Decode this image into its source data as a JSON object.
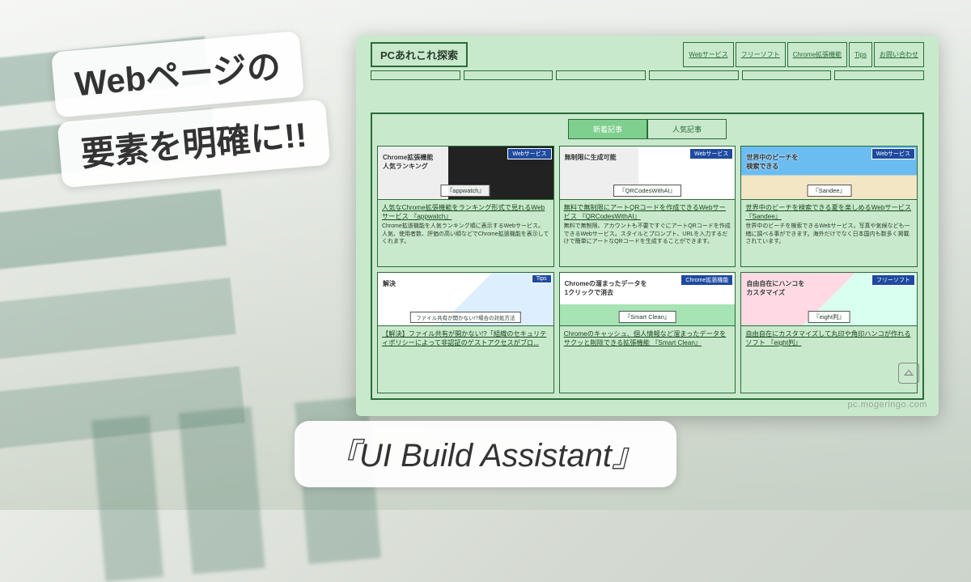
{
  "headline": {
    "line1": "Webページの",
    "line2": "要素を明確に!!"
  },
  "footer_title": "『UI Build Assistant』",
  "watermark": "pc.mogeringo.com",
  "site": {
    "title": "PCあれこれ探索",
    "nav": [
      "Webサービス",
      "フリーソフト",
      "Chrome拡張機能",
      "Tips",
      "お問い合わせ"
    ],
    "tabs": {
      "active": "新着記事",
      "other": "人気記事"
    },
    "cards": [
      {
        "tag": "Webサービス",
        "thumb_caption": "Chrome拡張機能\n人気ランキング",
        "thumb_label": "『appwatch』",
        "thumb_class": "dark",
        "title": "人気なChrome拡張機能をランキング形式で見れるWebサービス 『appwatch』",
        "desc": "Chrome拡張機能を人気ランキング順に表示するWebサービス。人気、使用者数、評価の高い順などでChrome拡張機能を表示してくれます。"
      },
      {
        "tag": "Webサービス",
        "thumb_caption": "無制限に生成可能",
        "thumb_label": "『QRCodesWithAI』",
        "thumb_class": "qr",
        "title": "無料で無制限にアートQRコードを作成できるWebサービス 『QRCodesWithAI』",
        "desc": "無料で無制限、アカウントも不要ですぐにアートQRコードを作成できるWebサービス。スタイルとプロンプト、URLを入力するだけで簡単にアートなQRコードを生成することができます。"
      },
      {
        "tag": "Webサービス",
        "thumb_caption": "世界中のビーチを\n検索できる",
        "thumb_label": "『Sandee』",
        "thumb_class": "beach",
        "title": "世界中のビーチを検索できる夏を楽しめるWebサービス 『Sandee』",
        "desc": "世界中のビーチを検索できるWebサービス。写真や気候なども一緒に調べる事ができます。海外だけでなく日本国内も数多く掲載されています。"
      },
      {
        "tag": "Tips",
        "thumb_caption": "解決",
        "thumb_label": "ファイル共有が開かない!?場合の対処方法",
        "thumb_class": "",
        "title": "【解決】ファイル共有が開かない!?「組織のセキュリティポリシーによって非認証のゲストアクセスがブロ...",
        "desc": ""
      },
      {
        "tag": "Chrome拡張機能",
        "thumb_caption": "Chromeの溜まったデータを\n1クリックで消去",
        "thumb_label": "『Smart Clean』",
        "thumb_class": "chrome",
        "title": "Chromeのキャッシュ、個人情報など溜まったデータをサクッと削除できる拡張機能 『Smart Clean』",
        "desc": ""
      },
      {
        "tag": "フリーソフト",
        "thumb_caption": "自由自在にハンコを\nカスタマイズ",
        "thumb_label": "『eight判』",
        "thumb_class": "soft",
        "title": "自由自在にカスタマイズして丸印や角印ハンコが作れるソフト 『eight判』",
        "desc": ""
      }
    ]
  }
}
